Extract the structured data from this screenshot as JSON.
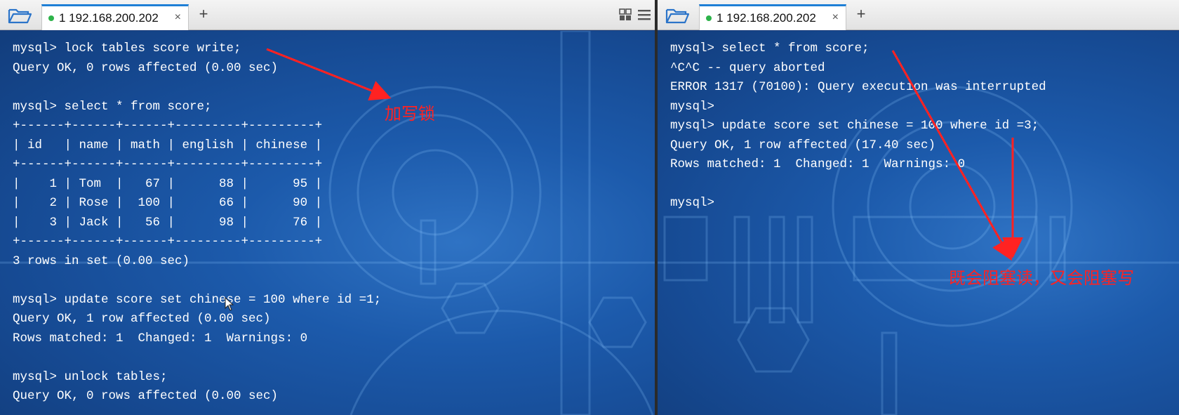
{
  "left_pane": {
    "tab": {
      "label": "1 192.168.200.202",
      "close": "×"
    },
    "add_tab": "+",
    "lines": [
      "mysql> lock tables score write;",
      "Query OK, 0 rows affected (0.00 sec)",
      "",
      "mysql> select * from score;",
      "+------+------+------+---------+---------+",
      "| id   | name | math | english | chinese |",
      "+------+------+------+---------+---------+",
      "|    1 | Tom  |   67 |      88 |      95 |",
      "|    2 | Rose |  100 |      66 |      90 |",
      "|    3 | Jack |   56 |      98 |      76 |",
      "+------+------+------+---------+---------+",
      "3 rows in set (0.00 sec)",
      "",
      "mysql> update score set chinese = 100 where id =1;",
      "Query OK, 1 row affected (0.00 sec)",
      "Rows matched: 1  Changed: 1  Warnings: 0",
      "",
      "mysql> unlock tables;",
      "Query OK, 0 rows affected (0.00 sec)"
    ],
    "annotation": "加写锁"
  },
  "right_pane": {
    "tab": {
      "label": "1 192.168.200.202",
      "close": "×"
    },
    "add_tab": "+",
    "lines": [
      "mysql> select * from score;",
      "^C^C -- query aborted",
      "ERROR 1317 (70100): Query execution was interrupted",
      "mysql>",
      "mysql> update score set chinese = 100 where id =3;",
      "Query OK, 1 row affected (17.40 sec)",
      "Rows matched: 1  Changed: 1  Warnings: 0",
      "",
      "mysql>"
    ],
    "annotation": "既会阻塞读，又会阻塞写"
  },
  "icons": {
    "folder": "folder-open-icon",
    "layout": "grid-layout-icon",
    "menu": "hamburger-menu-icon"
  },
  "colors": {
    "terminal_text": "#ffffff",
    "annotation": "#ff2222",
    "tab_accent": "#1f7fd6",
    "status_dot": "#2db34a"
  }
}
